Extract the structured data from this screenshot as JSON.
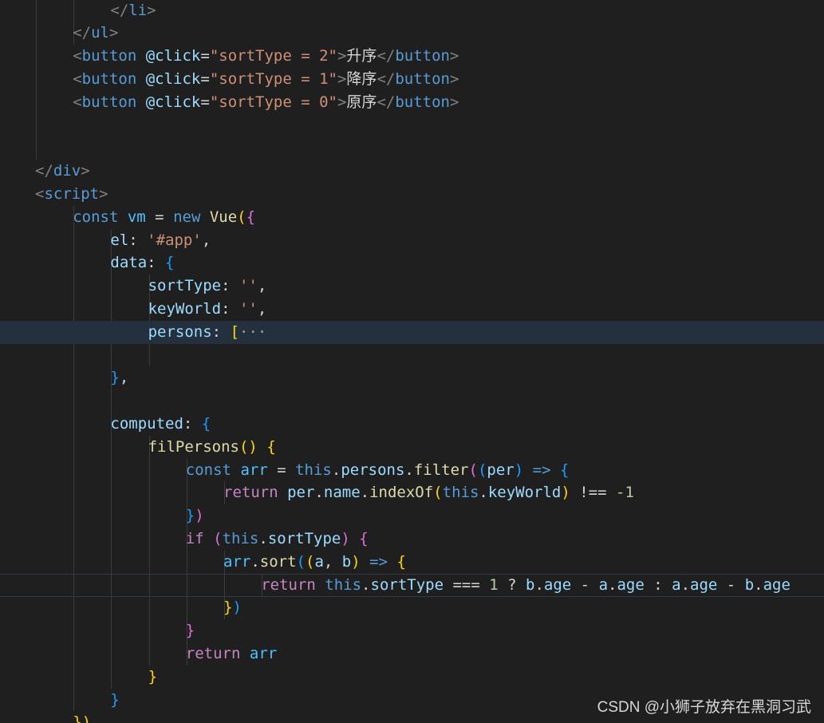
{
  "colors": {
    "background": "#1f1f1f",
    "active_line": "#24303d",
    "punctuation": "#808080",
    "tag": "#569cd6",
    "attribute": "#9cdcfe",
    "string": "#ce9178",
    "keyword": "#569cd6",
    "control": "#c586c0",
    "function": "#dcdcaa",
    "bracket_gold": "#ffd700",
    "bracket_pink": "#da70d6",
    "bracket_blue": "#179fff",
    "number": "#b5cea8",
    "text": "#d4d4d4"
  },
  "editor": {
    "lines": [
      {
        "indent": 2,
        "tokens": [
          {
            "t": "</",
            "c": "#808080"
          },
          {
            "t": "li",
            "c": "#569cd6"
          },
          {
            "t": ">",
            "c": "#808080"
          }
        ]
      },
      {
        "indent": 1,
        "tokens": [
          {
            "t": "</",
            "c": "#808080"
          },
          {
            "t": "ul",
            "c": "#569cd6"
          },
          {
            "t": ">",
            "c": "#808080"
          }
        ]
      },
      {
        "indent": 1,
        "tokens": [
          {
            "t": "<",
            "c": "#808080"
          },
          {
            "t": "button",
            "c": "#569cd6"
          },
          {
            "t": " @click",
            "c": "#9cdcfe"
          },
          {
            "t": "=",
            "c": "#d4d4d4"
          },
          {
            "t": "\"sortType = 2\"",
            "c": "#ce9178"
          },
          {
            "t": ">",
            "c": "#808080"
          },
          {
            "t": "升序",
            "c": "#d4d4d4"
          },
          {
            "t": "</",
            "c": "#808080"
          },
          {
            "t": "button",
            "c": "#569cd6"
          },
          {
            "t": ">",
            "c": "#808080"
          }
        ]
      },
      {
        "indent": 1,
        "tokens": [
          {
            "t": "<",
            "c": "#808080"
          },
          {
            "t": "button",
            "c": "#569cd6"
          },
          {
            "t": " @click",
            "c": "#9cdcfe"
          },
          {
            "t": "=",
            "c": "#d4d4d4"
          },
          {
            "t": "\"sortType = 1\"",
            "c": "#ce9178"
          },
          {
            "t": ">",
            "c": "#808080"
          },
          {
            "t": "降序",
            "c": "#d4d4d4"
          },
          {
            "t": "</",
            "c": "#808080"
          },
          {
            "t": "button",
            "c": "#569cd6"
          },
          {
            "t": ">",
            "c": "#808080"
          }
        ]
      },
      {
        "indent": 1,
        "tokens": [
          {
            "t": "<",
            "c": "#808080"
          },
          {
            "t": "button",
            "c": "#569cd6"
          },
          {
            "t": " @click",
            "c": "#9cdcfe"
          },
          {
            "t": "=",
            "c": "#d4d4d4"
          },
          {
            "t": "\"sortType = 0\"",
            "c": "#ce9178"
          },
          {
            "t": ">",
            "c": "#808080"
          },
          {
            "t": "原序",
            "c": "#d4d4d4"
          },
          {
            "t": "</",
            "c": "#808080"
          },
          {
            "t": "button",
            "c": "#569cd6"
          },
          {
            "t": ">",
            "c": "#808080"
          }
        ]
      },
      {
        "indent": 0,
        "tokens": []
      },
      {
        "indent": 0,
        "tokens": []
      },
      {
        "indent": 0,
        "tokens": [
          {
            "t": "</",
            "c": "#808080"
          },
          {
            "t": "div",
            "c": "#569cd6"
          },
          {
            "t": ">",
            "c": "#808080"
          }
        ]
      },
      {
        "indent": 0,
        "tokens": [
          {
            "t": "<",
            "c": "#808080"
          },
          {
            "t": "script",
            "c": "#569cd6"
          },
          {
            "t": ">",
            "c": "#808080"
          }
        ]
      },
      {
        "indent": 1,
        "tokens": [
          {
            "t": "const",
            "c": "#569cd6"
          },
          {
            "t": " ",
            "c": "#d4d4d4"
          },
          {
            "t": "vm",
            "c": "#4fc1ff"
          },
          {
            "t": " = ",
            "c": "#d4d4d4"
          },
          {
            "t": "new",
            "c": "#569cd6"
          },
          {
            "t": " ",
            "c": "#d4d4d4"
          },
          {
            "t": "Vue",
            "c": "#dcdcaa"
          },
          {
            "t": "(",
            "c": "#ffd700"
          },
          {
            "t": "{",
            "c": "#da70d6"
          }
        ]
      },
      {
        "indent": 2,
        "tokens": [
          {
            "t": "el",
            "c": "#9cdcfe"
          },
          {
            "t": ": ",
            "c": "#d4d4d4"
          },
          {
            "t": "'#app'",
            "c": "#ce9178"
          },
          {
            "t": ",",
            "c": "#d4d4d4"
          }
        ]
      },
      {
        "indent": 2,
        "tokens": [
          {
            "t": "data",
            "c": "#9cdcfe"
          },
          {
            "t": ": ",
            "c": "#d4d4d4"
          },
          {
            "t": "{",
            "c": "#179fff"
          }
        ]
      },
      {
        "indent": 3,
        "tokens": [
          {
            "t": "sortType",
            "c": "#9cdcfe"
          },
          {
            "t": ": ",
            "c": "#d4d4d4"
          },
          {
            "t": "''",
            "c": "#ce9178"
          },
          {
            "t": ",",
            "c": "#d4d4d4"
          }
        ]
      },
      {
        "indent": 3,
        "tokens": [
          {
            "t": "keyWorld",
            "c": "#9cdcfe"
          },
          {
            "t": ": ",
            "c": "#d4d4d4"
          },
          {
            "t": "''",
            "c": "#ce9178"
          },
          {
            "t": ",",
            "c": "#d4d4d4"
          }
        ]
      },
      {
        "indent": 3,
        "active": true,
        "tokens": [
          {
            "t": "persons",
            "c": "#9cdcfe"
          },
          {
            "t": ": ",
            "c": "#d4d4d4"
          },
          {
            "t": "[",
            "c": "#ffd700"
          },
          {
            "t": "···",
            "c": "#a0a0a0"
          }
        ]
      },
      {
        "indent": 0,
        "tokens": []
      },
      {
        "indent": 2,
        "tokens": [
          {
            "t": "}",
            "c": "#179fff"
          },
          {
            "t": ",",
            "c": "#d4d4d4"
          }
        ]
      },
      {
        "indent": 0,
        "tokens": []
      },
      {
        "indent": 2,
        "tokens": [
          {
            "t": "computed",
            "c": "#9cdcfe"
          },
          {
            "t": ": ",
            "c": "#d4d4d4"
          },
          {
            "t": "{",
            "c": "#179fff"
          }
        ]
      },
      {
        "indent": 3,
        "tokens": [
          {
            "t": "filPersons",
            "c": "#dcdcaa"
          },
          {
            "t": "() ",
            "c": "#ffd700"
          },
          {
            "t": "{",
            "c": "#ffd700"
          }
        ]
      },
      {
        "indent": 4,
        "tokens": [
          {
            "t": "const",
            "c": "#569cd6"
          },
          {
            "t": " ",
            "c": "#d4d4d4"
          },
          {
            "t": "arr",
            "c": "#4fc1ff"
          },
          {
            "t": " = ",
            "c": "#d4d4d4"
          },
          {
            "t": "this",
            "c": "#569cd6"
          },
          {
            "t": ".",
            "c": "#d4d4d4"
          },
          {
            "t": "persons",
            "c": "#9cdcfe"
          },
          {
            "t": ".",
            "c": "#d4d4d4"
          },
          {
            "t": "filter",
            "c": "#dcdcaa"
          },
          {
            "t": "(",
            "c": "#da70d6"
          },
          {
            "t": "(",
            "c": "#179fff"
          },
          {
            "t": "per",
            "c": "#9cdcfe"
          },
          {
            "t": ")",
            "c": "#179fff"
          },
          {
            "t": " ",
            "c": "#d4d4d4"
          },
          {
            "t": "=>",
            "c": "#569cd6"
          },
          {
            "t": " ",
            "c": "#d4d4d4"
          },
          {
            "t": "{",
            "c": "#179fff"
          }
        ]
      },
      {
        "indent": 5,
        "tokens": [
          {
            "t": "return",
            "c": "#c586c0"
          },
          {
            "t": " ",
            "c": "#d4d4d4"
          },
          {
            "t": "per",
            "c": "#9cdcfe"
          },
          {
            "t": ".",
            "c": "#d4d4d4"
          },
          {
            "t": "name",
            "c": "#9cdcfe"
          },
          {
            "t": ".",
            "c": "#d4d4d4"
          },
          {
            "t": "indexOf",
            "c": "#dcdcaa"
          },
          {
            "t": "(",
            "c": "#ffd700"
          },
          {
            "t": "this",
            "c": "#569cd6"
          },
          {
            "t": ".",
            "c": "#d4d4d4"
          },
          {
            "t": "keyWorld",
            "c": "#9cdcfe"
          },
          {
            "t": ")",
            "c": "#ffd700"
          },
          {
            "t": " !== ",
            "c": "#d4d4d4"
          },
          {
            "t": "-1",
            "c": "#b5cea8"
          }
        ]
      },
      {
        "indent": 4,
        "tokens": [
          {
            "t": "}",
            "c": "#179fff"
          },
          {
            "t": ")",
            "c": "#da70d6"
          }
        ]
      },
      {
        "indent": 4,
        "tokens": [
          {
            "t": "if",
            "c": "#c586c0"
          },
          {
            "t": " ",
            "c": "#d4d4d4"
          },
          {
            "t": "(",
            "c": "#da70d6"
          },
          {
            "t": "this",
            "c": "#569cd6"
          },
          {
            "t": ".",
            "c": "#d4d4d4"
          },
          {
            "t": "sortType",
            "c": "#9cdcfe"
          },
          {
            "t": ")",
            "c": "#da70d6"
          },
          {
            "t": " ",
            "c": "#d4d4d4"
          },
          {
            "t": "{",
            "c": "#da70d6"
          }
        ]
      },
      {
        "indent": 5,
        "tokens": [
          {
            "t": "arr",
            "c": "#4fc1ff"
          },
          {
            "t": ".",
            "c": "#d4d4d4"
          },
          {
            "t": "sort",
            "c": "#dcdcaa"
          },
          {
            "t": "(",
            "c": "#179fff"
          },
          {
            "t": "(",
            "c": "#ffd700"
          },
          {
            "t": "a",
            "c": "#9cdcfe"
          },
          {
            "t": ", ",
            "c": "#d4d4d4"
          },
          {
            "t": "b",
            "c": "#9cdcfe"
          },
          {
            "t": ")",
            "c": "#ffd700"
          },
          {
            "t": " ",
            "c": "#d4d4d4"
          },
          {
            "t": "=>",
            "c": "#569cd6"
          },
          {
            "t": " ",
            "c": "#d4d4d4"
          },
          {
            "t": "{",
            "c": "#ffd700"
          }
        ]
      },
      {
        "indent": 6,
        "cursor": true,
        "tokens": [
          {
            "t": "return",
            "c": "#c586c0"
          },
          {
            "t": " ",
            "c": "#d4d4d4"
          },
          {
            "t": "this",
            "c": "#569cd6"
          },
          {
            "t": ".",
            "c": "#d4d4d4"
          },
          {
            "t": "sortType",
            "c": "#9cdcfe"
          },
          {
            "t": " === ",
            "c": "#d4d4d4"
          },
          {
            "t": "1",
            "c": "#b5cea8"
          },
          {
            "t": " ? ",
            "c": "#d4d4d4"
          },
          {
            "t": "b",
            "c": "#9cdcfe"
          },
          {
            "t": ".",
            "c": "#d4d4d4"
          },
          {
            "t": "age",
            "c": "#9cdcfe"
          },
          {
            "t": " - ",
            "c": "#d4d4d4"
          },
          {
            "t": "a",
            "c": "#9cdcfe"
          },
          {
            "t": ".",
            "c": "#d4d4d4"
          },
          {
            "t": "age",
            "c": "#9cdcfe"
          },
          {
            "t": " : ",
            "c": "#d4d4d4"
          },
          {
            "t": "a",
            "c": "#9cdcfe"
          },
          {
            "t": ".",
            "c": "#d4d4d4"
          },
          {
            "t": "age",
            "c": "#9cdcfe"
          },
          {
            "t": " - ",
            "c": "#d4d4d4"
          },
          {
            "t": "b",
            "c": "#9cdcfe"
          },
          {
            "t": ".",
            "c": "#d4d4d4"
          },
          {
            "t": "age",
            "c": "#9cdcfe"
          }
        ]
      },
      {
        "indent": 5,
        "tokens": [
          {
            "t": "}",
            "c": "#ffd700"
          },
          {
            "t": ")",
            "c": "#179fff"
          }
        ]
      },
      {
        "indent": 4,
        "tokens": [
          {
            "t": "}",
            "c": "#da70d6"
          }
        ]
      },
      {
        "indent": 4,
        "tokens": [
          {
            "t": "return",
            "c": "#c586c0"
          },
          {
            "t": " ",
            "c": "#d4d4d4"
          },
          {
            "t": "arr",
            "c": "#4fc1ff"
          }
        ]
      },
      {
        "indent": 3,
        "tokens": [
          {
            "t": "}",
            "c": "#ffd700"
          }
        ]
      },
      {
        "indent": 2,
        "tokens": [
          {
            "t": "}",
            "c": "#179fff"
          }
        ]
      },
      {
        "indent": 1,
        "tokens": [
          {
            "t": "})",
            "c": "#ffd700"
          }
        ]
      }
    ]
  },
  "watermark": {
    "text": "CSDN @小狮子放弃在黑洞习武"
  }
}
